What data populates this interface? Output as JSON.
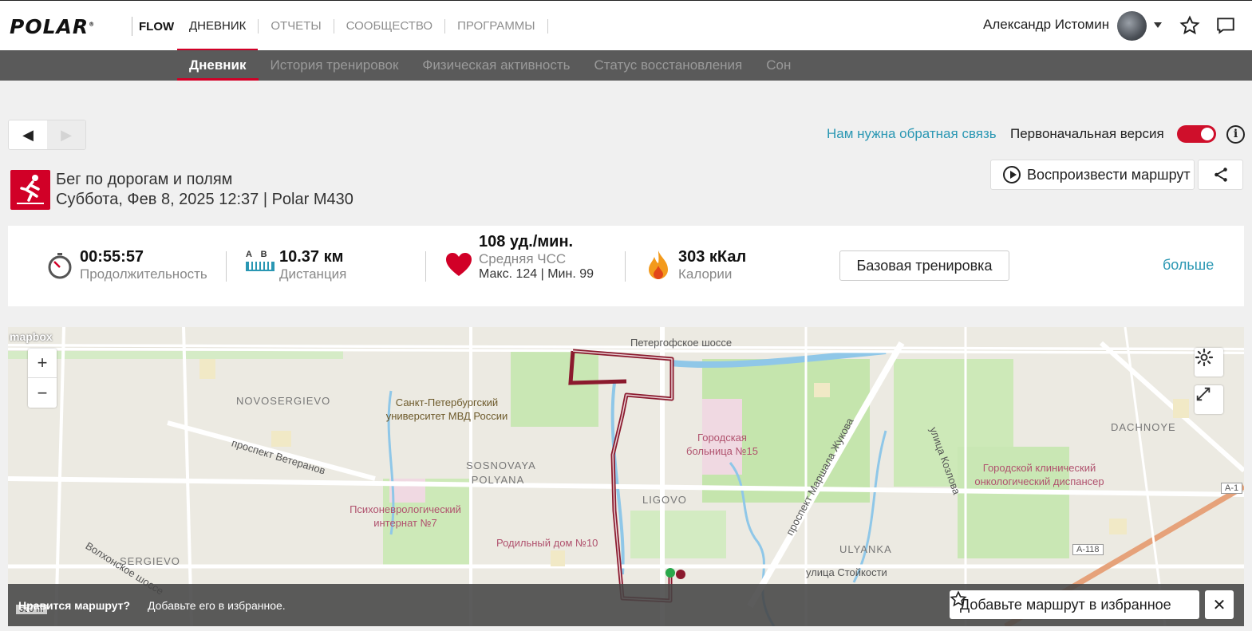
{
  "brand": {
    "logo": "POLAR",
    "product": "FLOW"
  },
  "nav": [
    {
      "label": "ДНЕВНИК",
      "active": true
    },
    {
      "label": "ОТЧЕТЫ",
      "active": false
    },
    {
      "label": "СООБЩЕСТВО",
      "active": false
    },
    {
      "label": "ПРОГРАММЫ",
      "active": false
    }
  ],
  "user": {
    "name": "Александр Истомин"
  },
  "subnav": [
    {
      "label": "Дневник",
      "active": true
    },
    {
      "label": "История тренировок",
      "active": false
    },
    {
      "label": "Физическая активность",
      "active": false
    },
    {
      "label": "Статус восстановления",
      "active": false
    },
    {
      "label": "Сон",
      "active": false
    }
  ],
  "pager": {
    "prev": "◀",
    "next": "▶"
  },
  "feedback": {
    "link": "Нам нужна обратная связь",
    "original_version": "Первоначальная версия",
    "toggle_on": true
  },
  "exercise": {
    "sport": "Бег по дорогам и полям",
    "date_device": "Суббота, Фев 8, 2025 12:37 | Polar M430"
  },
  "actions": {
    "play_route": "Воспроизвести маршрут"
  },
  "stats": {
    "duration": {
      "value": "00:55:57",
      "label": "Продолжительность"
    },
    "distance": {
      "value": "10.37 км",
      "label": "Дистанция",
      "icon_text": "A B"
    },
    "heart_rate": {
      "value": "108 уд./мин.",
      "label": "Средняя ЧСС",
      "detail": "Макс. 124  |  Мин. 99"
    },
    "calories": {
      "value": "303 кКал",
      "label": "Калории"
    },
    "base_training": "Базовая тренировка",
    "more": "больше"
  },
  "map": {
    "attribution": "mapbox",
    "scale": "500 m",
    "places": [
      "NOVOSERGIEVO",
      "SOSNOVAYA POLYANA",
      "SERGIEVO",
      "LIGOVO",
      "ULYANKA",
      "DACHNOYE"
    ],
    "pois": [
      "Санкт-Петербургский университет МВД России",
      "Психоневрологический интернат №7",
      "Родильный дом №10",
      "Городская больница №15",
      "Городской клинический онкологический диспансер"
    ],
    "streets": [
      "Петергофское шоссе",
      "проспект Ветеранов",
      "проспект Маршала Жукова",
      "улица Козлова",
      "улица Стойкости",
      "Волхонское шоссе",
      "А-118",
      "А-1"
    ],
    "banner_question": "Нравится маршрут?",
    "banner_text": "Добавьте его в избранное.",
    "add_favorite": "Добавьте маршрут в избранное",
    "zoom_in": "+",
    "zoom_out": "−"
  },
  "colors": {
    "accent": "#d10027",
    "link": "#2a97b3",
    "route": "#8b1a2e"
  }
}
